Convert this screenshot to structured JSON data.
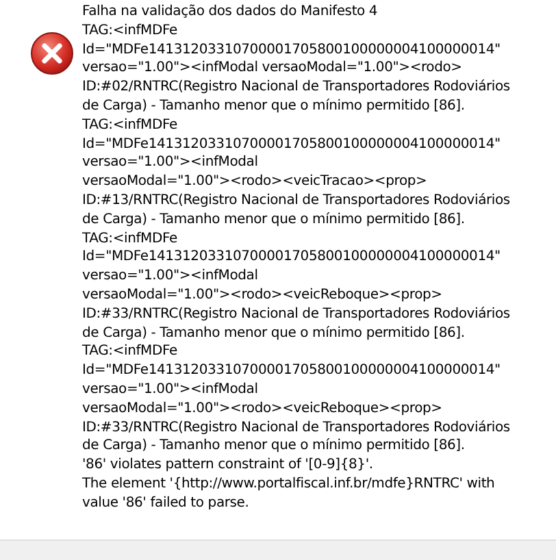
{
  "message": {
    "lines": [
      "Falha na validação dos dados do Manifesto 4",
      "TAG:<infMDFe",
      "Id=\"MDFe14131203310700001705800100000004100000014\"",
      "versao=\"1.00\"><infModal versaoModal=\"1.00\"><rodo>",
      "ID:#02/RNTRC(Registro Nacional de Transportadores Rodoviários",
      "de Carga) - Tamanho menor que o mínimo permitido [86].",
      "TAG:<infMDFe",
      "Id=\"MDFe14131203310700001705800100000004100000014\"",
      "versao=\"1.00\"><infModal",
      "versaoModal=\"1.00\"><rodo><veicTracao><prop>",
      "ID:#13/RNTRC(Registro Nacional de Transportadores Rodoviários",
      "de Carga) - Tamanho menor que o mínimo permitido [86].",
      "TAG:<infMDFe",
      "Id=\"MDFe14131203310700001705800100000004100000014\"",
      "versao=\"1.00\"><infModal",
      "versaoModal=\"1.00\"><rodo><veicReboque><prop>",
      "ID:#33/RNTRC(Registro Nacional de Transportadores Rodoviários",
      "de Carga) - Tamanho menor que o mínimo permitido [86].",
      "TAG:<infMDFe",
      "Id=\"MDFe14131203310700001705800100000004100000014\"",
      "versao=\"1.00\"><infModal",
      "versaoModal=\"1.00\"><rodo><veicReboque><prop>",
      "ID:#33/RNTRC(Registro Nacional de Transportadores Rodoviários",
      "de Carga) - Tamanho menor que o mínimo permitido [86].",
      "'86' violates pattern constraint of '[0-9]{8}'.",
      "The element '{http://www.portalfiscal.inf.br/mdfe}RNTRC' with",
      "value '86' failed to parse."
    ]
  }
}
